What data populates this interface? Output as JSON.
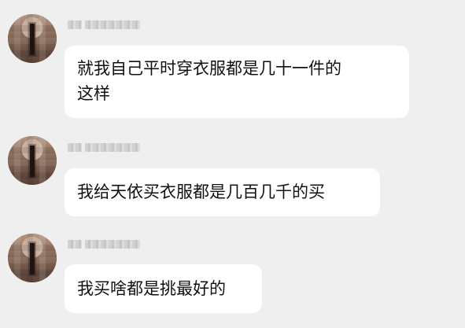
{
  "chat": {
    "messages": [
      {
        "sender": "",
        "text": "就我自己平时穿衣服都是几十一件的\n这样"
      },
      {
        "sender": "",
        "text": "我给天依买衣服都是几百几千的买"
      },
      {
        "sender": "",
        "text": "我买啥都是挑最好的"
      }
    ]
  }
}
